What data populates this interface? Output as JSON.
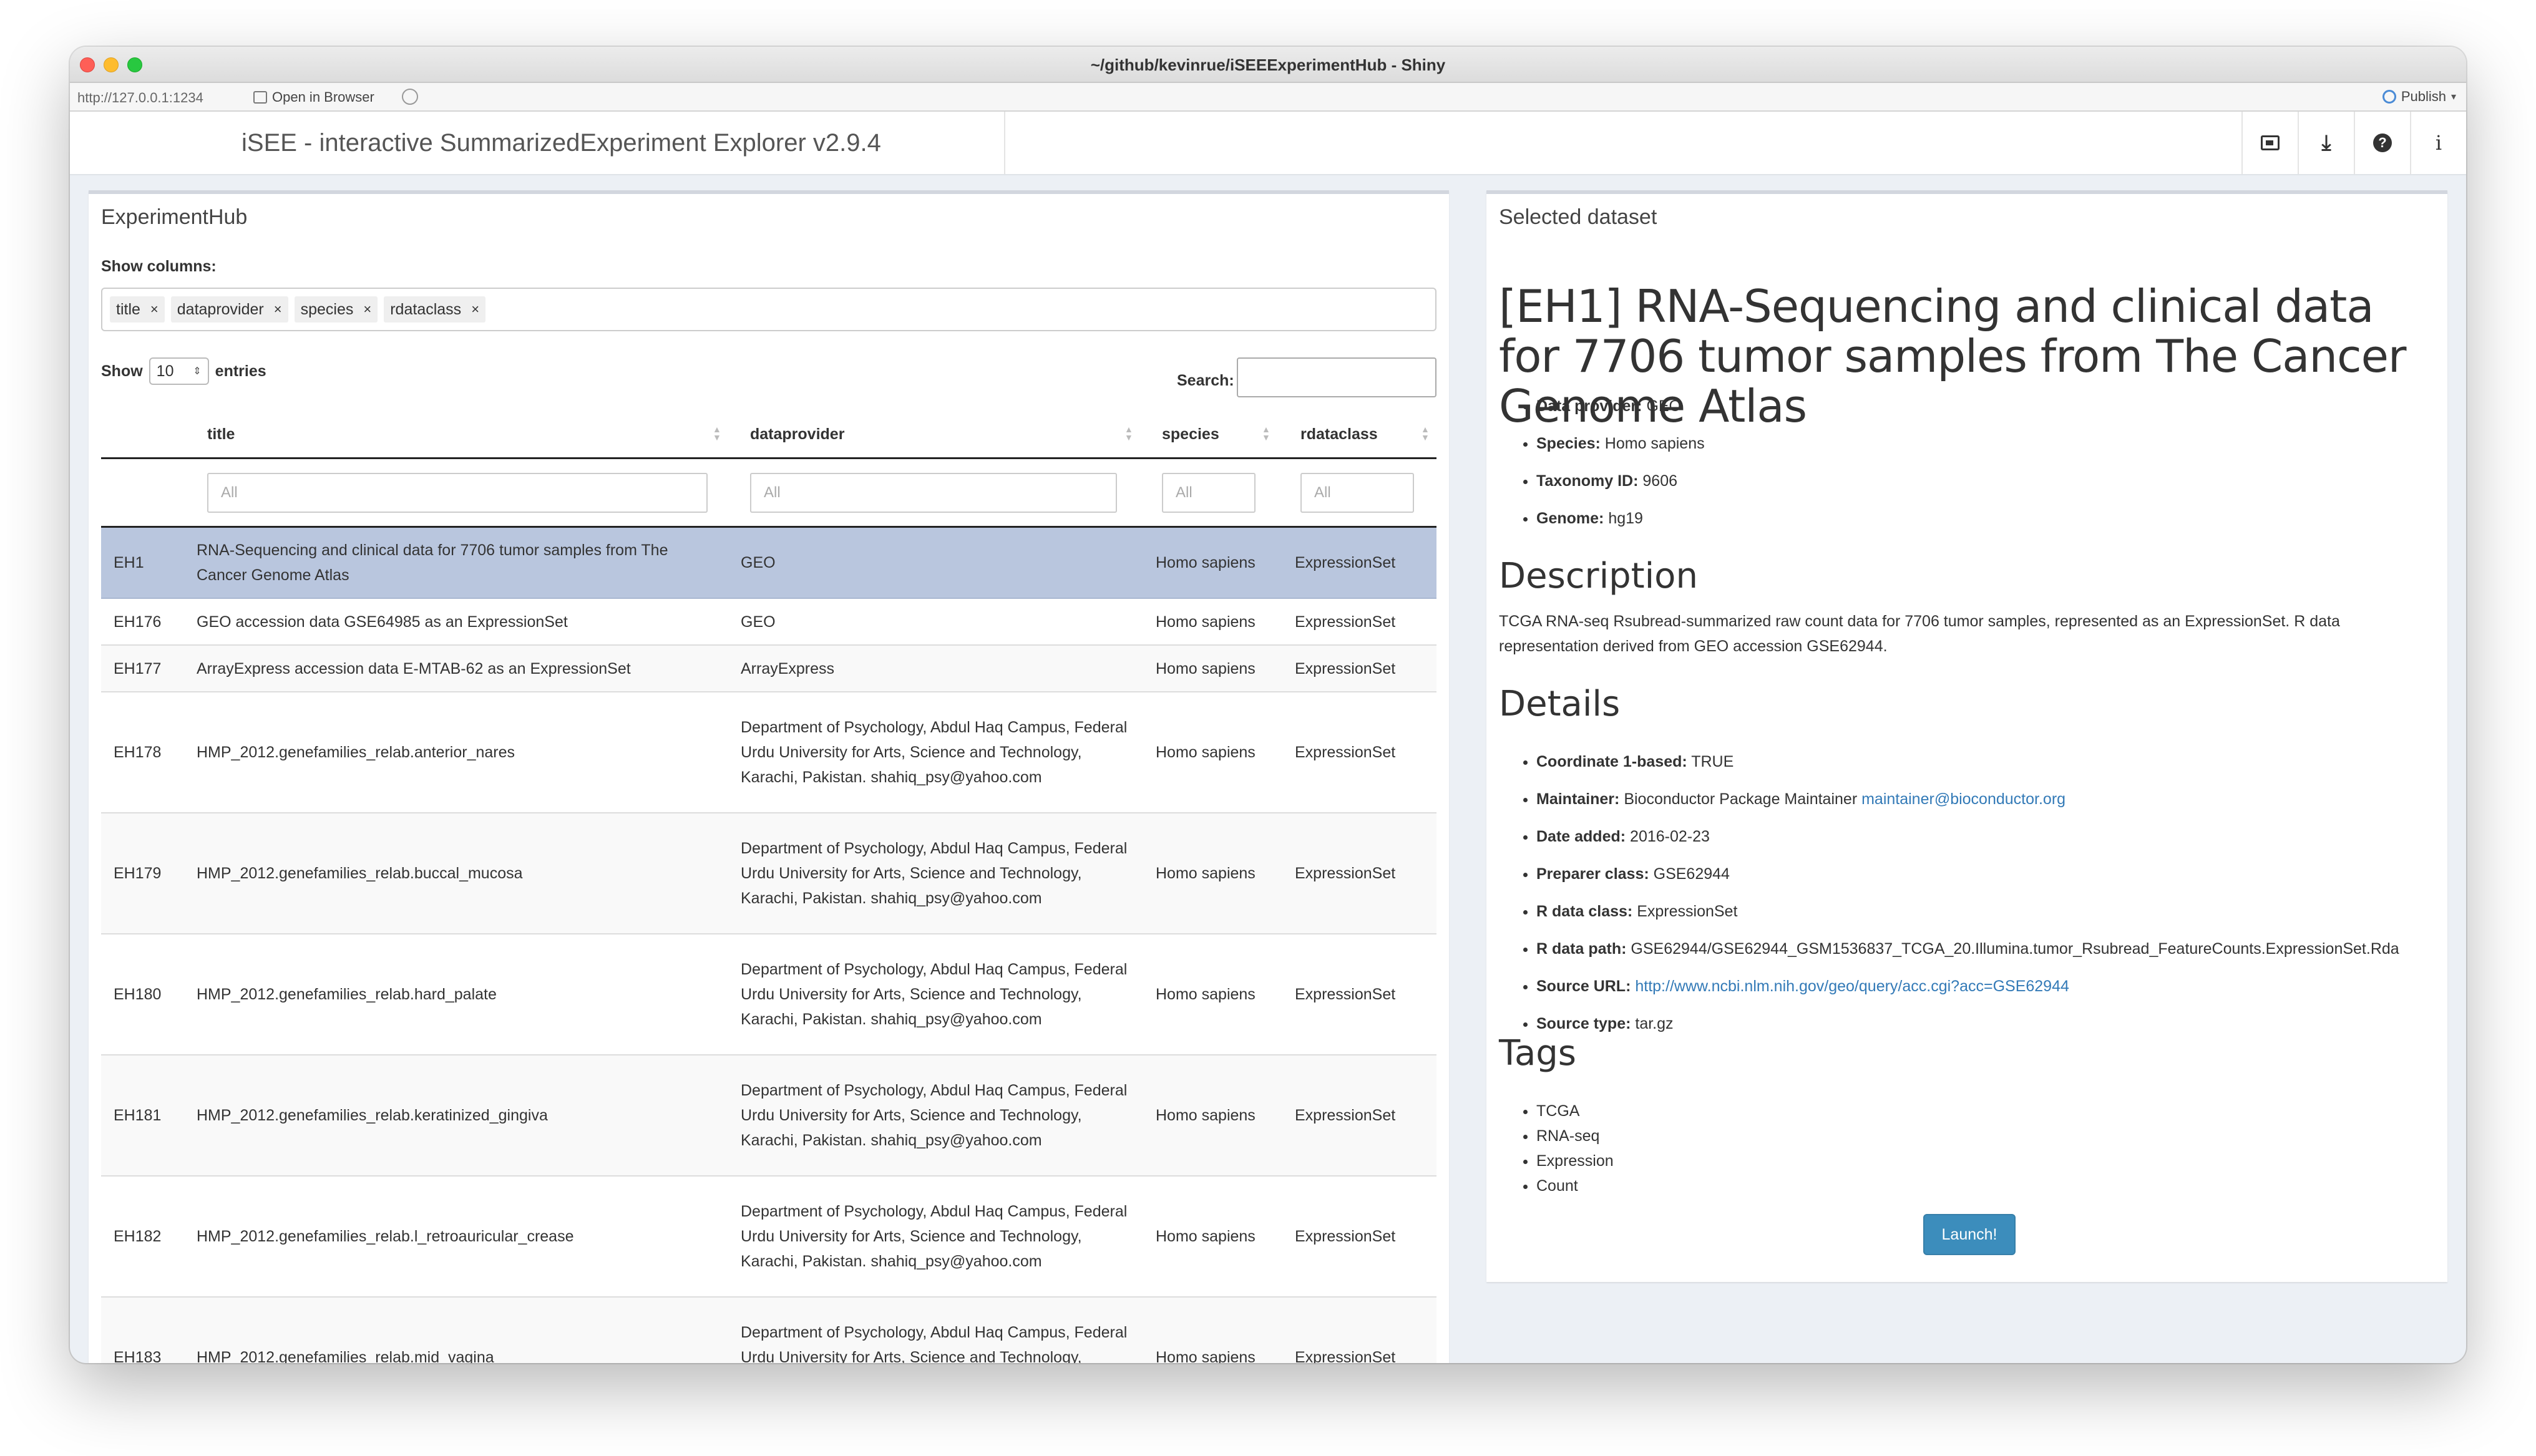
{
  "window": {
    "title": "~/github/kevinrue/iSEEExperimentHub - Shiny"
  },
  "addressbar": {
    "url": "http://127.0.0.1:1234",
    "open_in_browser": "Open in Browser",
    "publish": "Publish"
  },
  "header": {
    "app_title": "iSEE - interactive SummarizedExperiment Explorer v2.9.4",
    "icons": [
      "image-icon",
      "download-icon",
      "help-icon",
      "info-icon"
    ]
  },
  "left_panel": {
    "heading": "ExperimentHub",
    "show_columns_label": "Show columns:",
    "columns": [
      "title",
      "dataprovider",
      "species",
      "rdataclass"
    ],
    "chip_remove": "×",
    "show_label": "Show",
    "entries_value": "10",
    "entries_label": "entries",
    "search_label": "Search:",
    "search_value": "",
    "table": {
      "headers": [
        "title",
        "dataprovider",
        "species",
        "rdataclass"
      ],
      "filter_placeholder": "All",
      "rows": [
        {
          "id": "EH1",
          "title": "RNA-Sequencing and clinical data for 7706 tumor samples from The Cancer Genome Atlas",
          "provider": "GEO",
          "species": "Homo sapiens",
          "class": "ExpressionSet",
          "selected": true
        },
        {
          "id": "EH176",
          "title": "GEO accession data GSE64985 as an ExpressionSet",
          "provider": "GEO",
          "species": "Homo sapiens",
          "class": "ExpressionSet"
        },
        {
          "id": "EH177",
          "title": "ArrayExpress accession data E-MTAB-62 as an ExpressionSet",
          "provider": "ArrayExpress",
          "species": "Homo sapiens",
          "class": "ExpressionSet"
        },
        {
          "id": "EH178",
          "title": "HMP_2012.genefamilies_relab.anterior_nares",
          "provider": "Department of Psychology, Abdul Haq Campus, Federal Urdu University for Arts, Science and Technology, Karachi, Pakistan. shahiq_psy@yahoo.com",
          "species": "Homo sapiens",
          "class": "ExpressionSet"
        },
        {
          "id": "EH179",
          "title": "HMP_2012.genefamilies_relab.buccal_mucosa",
          "provider": "Department of Psychology, Abdul Haq Campus, Federal Urdu University for Arts, Science and Technology, Karachi, Pakistan. shahiq_psy@yahoo.com",
          "species": "Homo sapiens",
          "class": "ExpressionSet"
        },
        {
          "id": "EH180",
          "title": "HMP_2012.genefamilies_relab.hard_palate",
          "provider": "Department of Psychology, Abdul Haq Campus, Federal Urdu University for Arts, Science and Technology, Karachi, Pakistan. shahiq_psy@yahoo.com",
          "species": "Homo sapiens",
          "class": "ExpressionSet"
        },
        {
          "id": "EH181",
          "title": "HMP_2012.genefamilies_relab.keratinized_gingiva",
          "provider": "Department of Psychology, Abdul Haq Campus, Federal Urdu University for Arts, Science and Technology, Karachi, Pakistan. shahiq_psy@yahoo.com",
          "species": "Homo sapiens",
          "class": "ExpressionSet"
        },
        {
          "id": "EH182",
          "title": "HMP_2012.genefamilies_relab.l_retroauricular_crease",
          "provider": "Department of Psychology, Abdul Haq Campus, Federal Urdu University for Arts, Science and Technology, Karachi, Pakistan. shahiq_psy@yahoo.com",
          "species": "Homo sapiens",
          "class": "ExpressionSet"
        },
        {
          "id": "EH183",
          "title": "HMP_2012.genefamilies_relab.mid_vagina",
          "provider": "Department of Psychology, Abdul Haq Campus, Federal Urdu University for Arts, Science and Technology, Karachi, Pakistan.",
          "species": "Homo sapiens",
          "class": "ExpressionSet"
        }
      ]
    }
  },
  "right_panel": {
    "heading": "Selected dataset",
    "title": "[EH1] RNA-Sequencing and clinical data for 7706 tumor samples from The Cancer Genome Atlas",
    "meta": [
      {
        "key": "Data provider:",
        "value": "GEO"
      },
      {
        "key": "Species:",
        "value": "Homo sapiens"
      },
      {
        "key": "Taxonomy ID:",
        "value": "9606"
      },
      {
        "key": "Genome:",
        "value": "hg19"
      }
    ],
    "description_heading": "Description",
    "description": "TCGA RNA-seq Rsubread-summarized raw count data for 7706 tumor samples, represented as an ExpressionSet. R data representation derived from GEO accession GSE62944.",
    "details_heading": "Details",
    "details": {
      "coordinate_key": "Coordinate 1-based:",
      "coordinate_value": "TRUE",
      "maintainer_key": "Maintainer:",
      "maintainer_value": "Bioconductor Package Maintainer",
      "maintainer_link": "maintainer@bioconductor.org",
      "date_key": "Date added:",
      "date_value": "2016-02-23",
      "preparer_key": "Preparer class:",
      "preparer_value": "GSE62944",
      "rclass_key": "R data class:",
      "rclass_value": "ExpressionSet",
      "rpath_key": "R data path:",
      "rpath_value": "GSE62944/GSE62944_GSM1536837_TCGA_20.Illumina.tumor_Rsubread_FeatureCounts.ExpressionSet.Rda",
      "source_url_key": "Source URL:",
      "source_url_value": "http://www.ncbi.nlm.nih.gov/geo/query/acc.cgi?acc=GSE62944",
      "source_type_key": "Source type:",
      "source_type_value": "tar.gz"
    },
    "tags_heading": "Tags",
    "tags": [
      "TCGA",
      "RNA-seq",
      "Expression",
      "Count"
    ],
    "launch_label": "Launch!"
  },
  "colors": {
    "selected_row": "#b9c6de",
    "launch_button": "#3c8dbc",
    "link": "#337ab7"
  }
}
